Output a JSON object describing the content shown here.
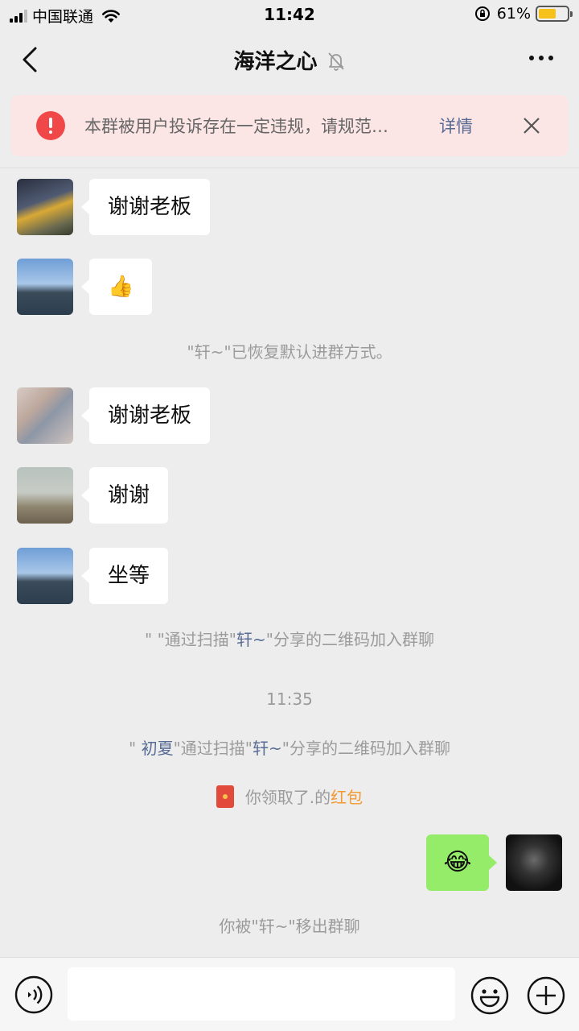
{
  "status_bar": {
    "carrier": "中国联通",
    "time": "11:42",
    "battery_percent": "61%",
    "battery_level": 0.61
  },
  "header": {
    "title": "海洋之心"
  },
  "warning": {
    "text": "本群被用户投诉存在一定违规，请规范…",
    "detail": "详情"
  },
  "messages": [
    {
      "type": "incoming",
      "text": "谢谢老板"
    },
    {
      "type": "incoming",
      "text": "👍"
    },
    {
      "type": "system",
      "text": "\"轩~\"已恢复默认进群方式。"
    },
    {
      "type": "incoming",
      "text": "谢谢老板"
    },
    {
      "type": "incoming",
      "text": "谢谢"
    },
    {
      "type": "incoming",
      "text": "坐等"
    },
    {
      "type": "system",
      "parts": [
        "\" \"通过扫描\"",
        "轩~",
        "\"分享的二维码加入群聊"
      ]
    },
    {
      "type": "time",
      "text": "11:35"
    },
    {
      "type": "system",
      "parts": [
        "\" ",
        "初夏",
        "\"通过扫描\"",
        "轩~",
        "\"分享的二维码加入群聊"
      ]
    },
    {
      "type": "system",
      "parts": [
        "你领取了.的",
        "红包"
      ]
    },
    {
      "type": "outgoing",
      "text": "😂"
    },
    {
      "type": "system",
      "text": "你被\"轩~\"移出群聊"
    }
  ]
}
